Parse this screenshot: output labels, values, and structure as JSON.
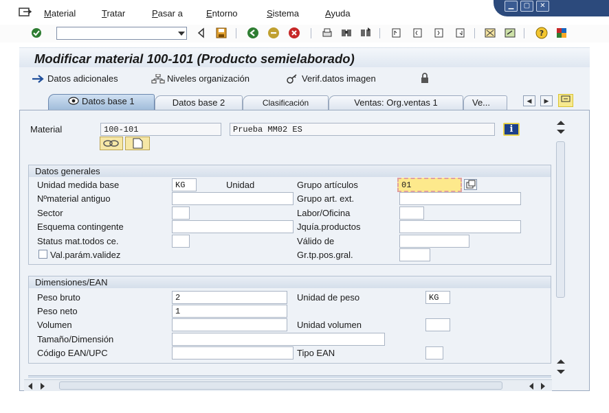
{
  "menu": {
    "items": [
      {
        "label": "Material",
        "u": "M",
        "rest": "aterial"
      },
      {
        "label": "Tratar",
        "u": "T",
        "rest": "ratar"
      },
      {
        "label": "Pasar a",
        "u": "P",
        "rest": "asar a"
      },
      {
        "label": "Entorno",
        "u": "E",
        "rest": "ntorno"
      },
      {
        "label": "Sistema",
        "u": "S",
        "rest": "istema"
      },
      {
        "label": "Ayuda",
        "u": "A",
        "rest": "yuda"
      }
    ]
  },
  "toolbar": {
    "command_field_value": ""
  },
  "title": "Modificar material 100-101 (Producto semielaborado)",
  "app_toolbar": {
    "additional_data": "Datos adicionales",
    "org_levels": "Niveles organización",
    "check_screen_data": "Verif.datos imagen"
  },
  "tabs": [
    {
      "label": "Datos base 1",
      "active": true
    },
    {
      "label": "Datos base 2",
      "active": false
    },
    {
      "label": "Clasificación",
      "active": false
    },
    {
      "label": "Ventas: Org.ventas 1",
      "active": false
    },
    {
      "label": "Ve...",
      "active": false
    }
  ],
  "header": {
    "material_label": "Material",
    "material_value": "100-101",
    "description_value": "Prueba MM02 ES"
  },
  "general_data": {
    "title": "Datos generales",
    "base_uom_label": "Unidad medida base",
    "base_uom_value": "KG",
    "base_uom_text": "Unidad",
    "old_material_label": "Nºmaterial antiguo",
    "old_material_value": "",
    "division_label": "Sector",
    "division_value": "",
    "contingent_label": "Esquema contingente",
    "contingent_value": "",
    "xplant_status_label": "Status mat.todos ce.",
    "xplant_status_value": "",
    "valid_params_label": "Val.parám.validez",
    "valid_params_checked": false,
    "material_group_label": "Grupo artículos",
    "material_group_value": "01",
    "ext_material_group_label": "Grupo art. ext.",
    "ext_material_group_value": "",
    "lab_office_label": "Labor/Oficina",
    "lab_office_value": "",
    "prod_hierarchy_label": "Jquía.productos",
    "prod_hierarchy_value": "",
    "valid_from_label": "Válido de",
    "valid_from_value": "",
    "gen_item_cat_label": "Gr.tp.pos.gral.",
    "gen_item_cat_value": ""
  },
  "dimensions": {
    "title": "Dimensiones/EAN",
    "gross_weight_label": "Peso bruto",
    "gross_weight_value": "2",
    "weight_unit_label": "Unidad de peso",
    "weight_unit_value": "KG",
    "net_weight_label": "Peso neto",
    "net_weight_value": "1",
    "volume_label": "Volumen",
    "volume_value": "",
    "volume_unit_label": "Unidad volumen",
    "volume_unit_value": "",
    "size_dims_label": "Tamaño/Dimensión",
    "size_dims_value": "",
    "ean_label": "Código EAN/UPC",
    "ean_value": "",
    "ean_type_label": "Tipo EAN",
    "ean_type_value": ""
  },
  "colors": {
    "accent_yellow": "#f7e98e",
    "window_blue": "#2c4a7c",
    "panel_bg": "#eef2f7"
  }
}
